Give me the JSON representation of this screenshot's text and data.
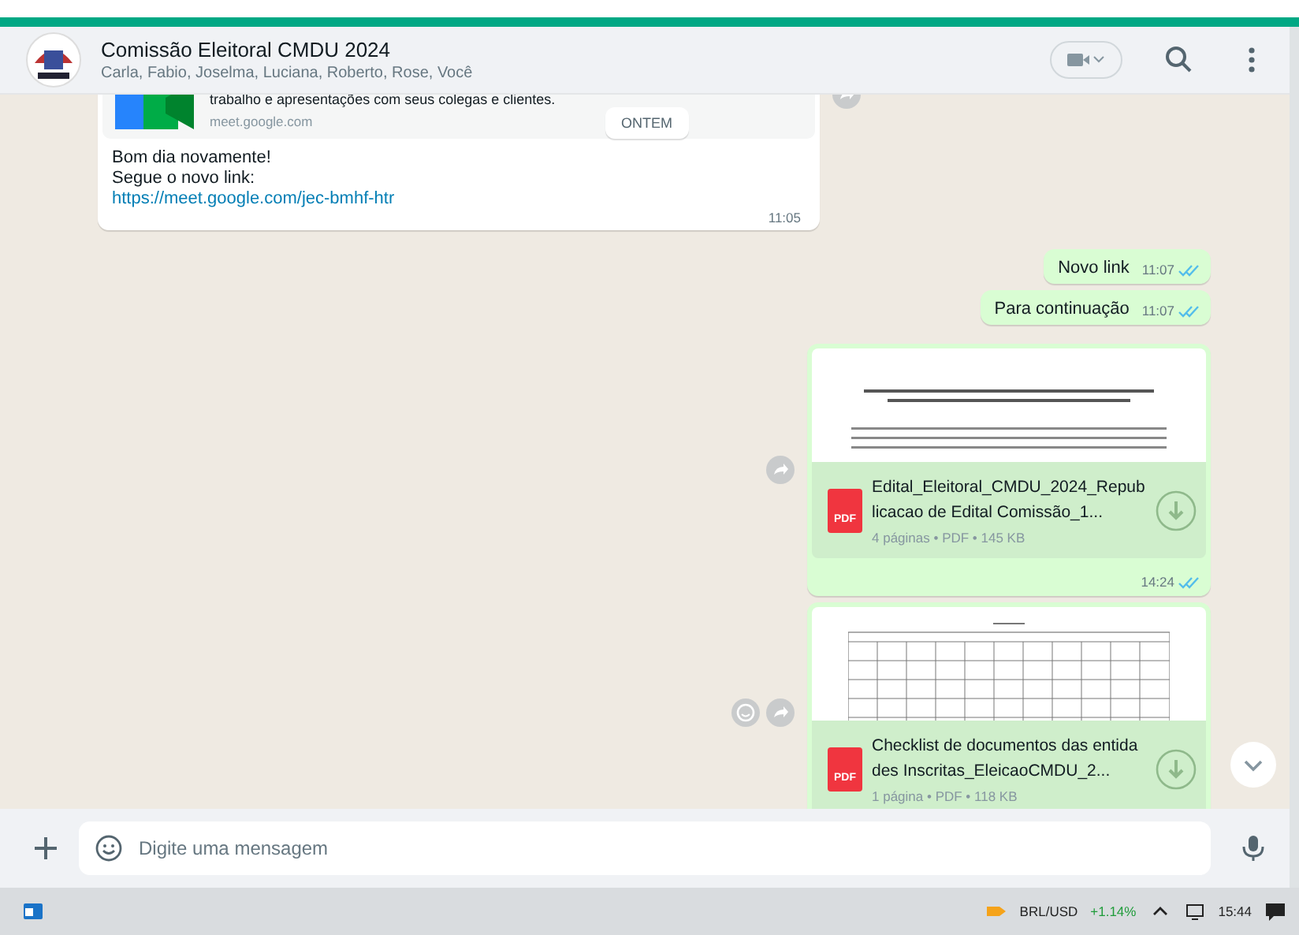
{
  "header": {
    "title": "Comissão Eleitoral CMDU 2024",
    "participants": "Carla, Fabio, Joselma, Luciana, Roberto, Rose, Você"
  },
  "date_chip": "ONTEM",
  "messages": [
    {
      "kind": "link",
      "preview_description": "trabalho e apresentações com seus colegas e clientes.",
      "preview_domain": "meet.google.com",
      "lines": [
        "Bom dia novamente!",
        "Segue o novo link:"
      ],
      "link": "https://meet.google.com/jec-bmhf-htr",
      "time": "11:05",
      "forward": true,
      "react": false
    },
    {
      "kind": "text",
      "text": "Novo link",
      "time": "11:07",
      "read": true,
      "forward": false,
      "react": false
    },
    {
      "kind": "text",
      "text": "Para continuação",
      "time": "11:07",
      "read": true,
      "forward": false,
      "react": false
    },
    {
      "kind": "document",
      "file_type": "PDF",
      "file_name": "Edital_Eleitoral_CMDU_2024_Republicacao de Edital Comissão_1...",
      "meta": "4 páginas • PDF • 145 KB",
      "time": "14:24",
      "read": true,
      "forward": true,
      "react": false
    },
    {
      "kind": "table",
      "file_type": "PDF",
      "file_name": "Checklist de documentos das entidades Inscritas_EleicaoCMDU_2...",
      "meta": "1 página • PDF • 118 KB",
      "forward": true,
      "react": true
    }
  ],
  "composer": {
    "placeholder": "Digite uma mensagem"
  },
  "taskbar": {
    "ticker": "BRL/USD",
    "change": "+1.14%",
    "clock": "15:44"
  }
}
